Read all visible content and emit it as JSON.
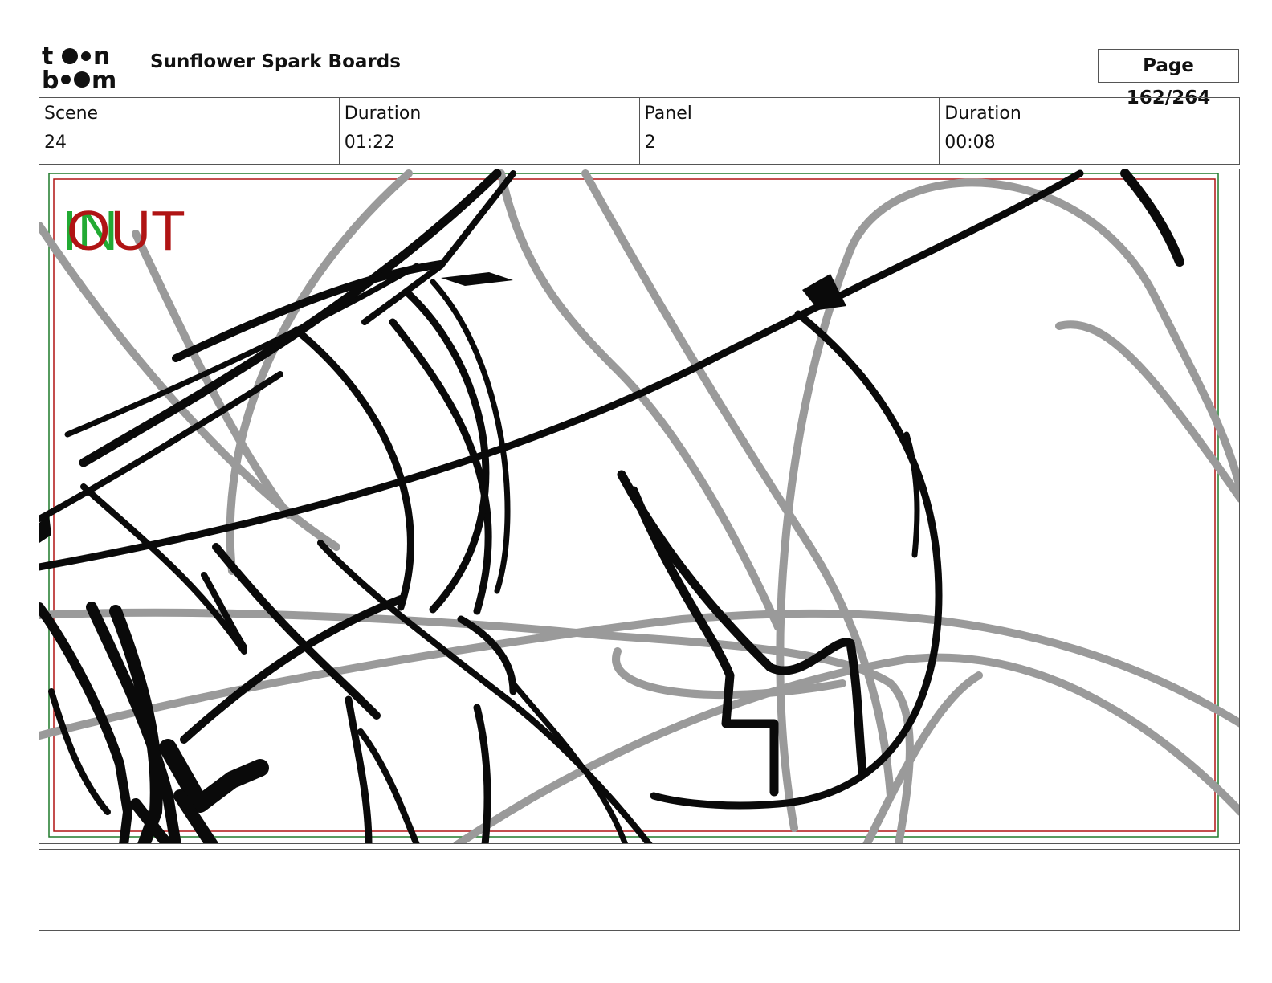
{
  "header": {
    "logo_text": "toon boom",
    "document_title": "Sunflower Spark Boards",
    "page_label": "Page 162/264"
  },
  "info": [
    {
      "label": "Scene",
      "value": "24"
    },
    {
      "label": "Duration",
      "value": "01:22"
    },
    {
      "label": "Panel",
      "value": "2"
    },
    {
      "label": "Duration",
      "value": "00:08"
    }
  ],
  "panel": {
    "in_marker": "IN",
    "out_marker": "OUT",
    "colors": {
      "in_marker": "#22aa33",
      "out_marker": "#b01414",
      "safe_frame_red": "#b01414",
      "safe_frame_green": "#1f7a2a",
      "sketch_gray": "#9a9a9a",
      "sketch_black": "#0a0a0a"
    }
  },
  "notes": {
    "text": ""
  }
}
